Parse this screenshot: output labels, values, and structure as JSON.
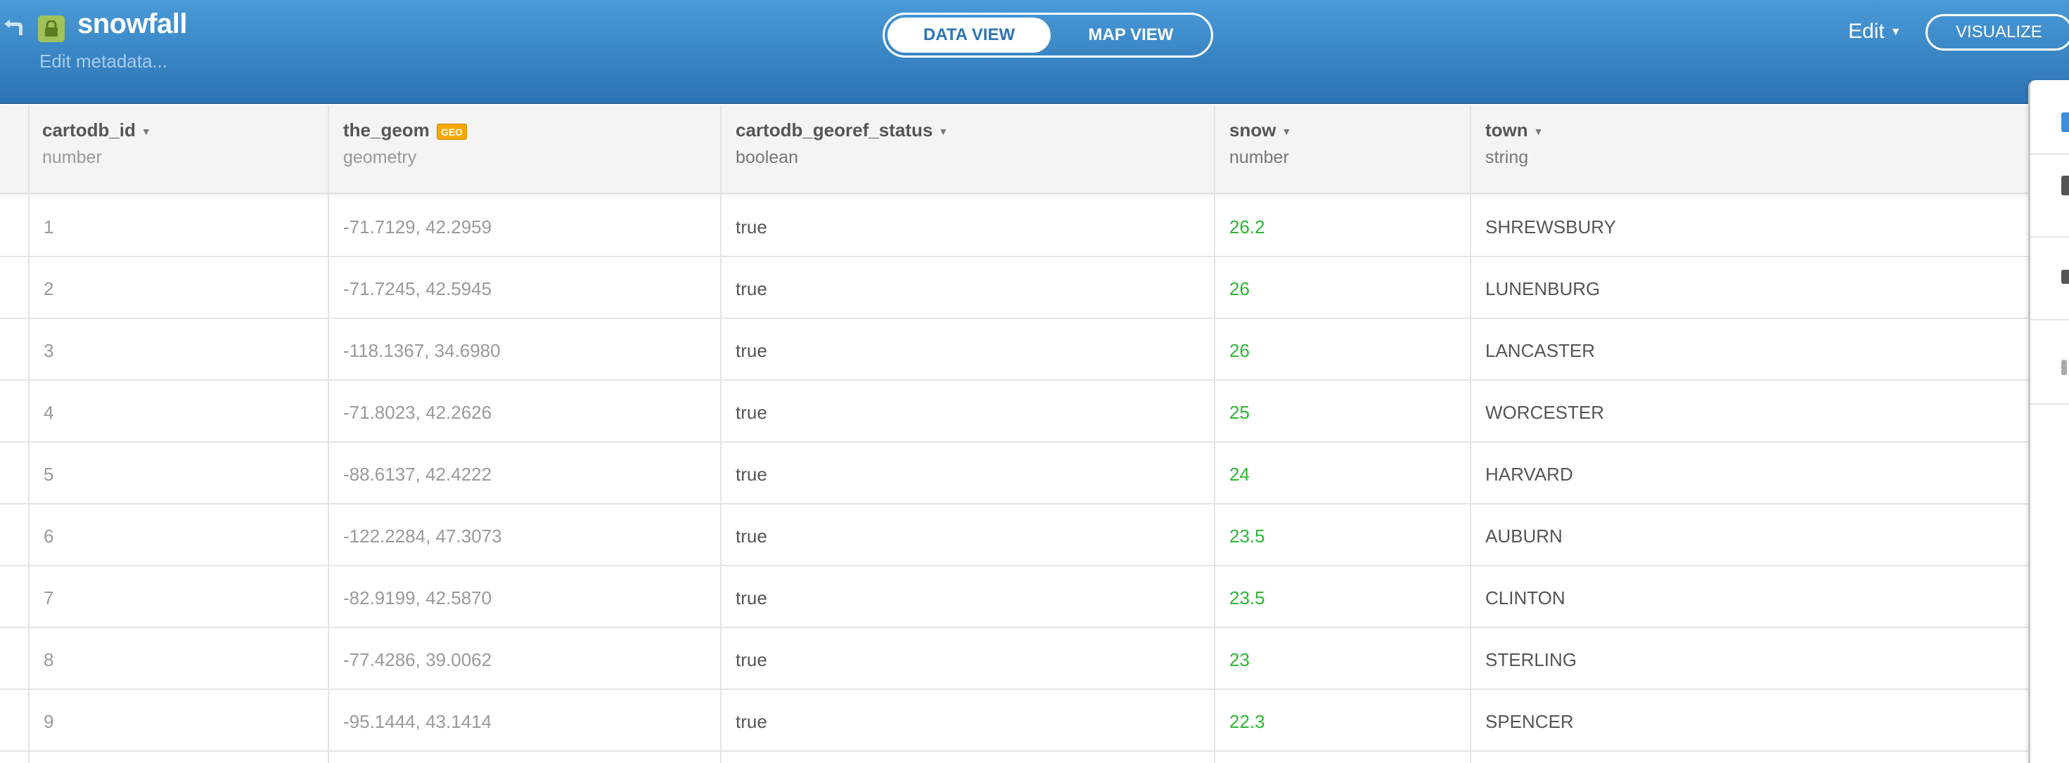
{
  "header": {
    "title": "snowfall",
    "edit_metadata": "Edit metadata...",
    "tabs": [
      "DATA VIEW",
      "MAP VIEW"
    ],
    "active_tab": "DATA VIEW",
    "edit_label": "Edit",
    "visualize_label": "VISUALIZE",
    "icons": {
      "back": "back-arrow-icon",
      "lock": "lock-icon"
    }
  },
  "table": {
    "columns": [
      {
        "name": "cartodb_id",
        "type": "number"
      },
      {
        "name": "the_geom",
        "type": "geometry",
        "badge": "GEO"
      },
      {
        "name": "cartodb_georef_status",
        "type": "boolean"
      },
      {
        "name": "snow",
        "type": "number"
      },
      {
        "name": "town",
        "type": "string"
      }
    ],
    "rows": [
      [
        "1",
        "-71.7129, 42.2959",
        "true",
        "26.2",
        "SHREWSBURY"
      ],
      [
        "2",
        "-71.7245, 42.5945",
        "true",
        "26",
        "LUNENBURG"
      ],
      [
        "3",
        "-118.1367, 34.6980",
        "true",
        "26",
        "LANCASTER"
      ],
      [
        "4",
        "-71.8023, 42.2626",
        "true",
        "25",
        "WORCESTER"
      ],
      [
        "5",
        "-88.6137, 42.4222",
        "true",
        "24",
        "HARVARD"
      ],
      [
        "6",
        "-122.2284, 47.3073",
        "true",
        "23.5",
        "AUBURN"
      ],
      [
        "7",
        "-82.9199, 42.5870",
        "true",
        "23.5",
        "CLINTON"
      ],
      [
        "8",
        "-77.4286, 39.0062",
        "true",
        "23",
        "STERLING"
      ],
      [
        "9",
        "-95.1444, 43.1414",
        "true",
        "22.3",
        "SPENCER"
      ]
    ]
  },
  "colors": {
    "header_top": "#4a9ad8",
    "header_bottom": "#2c74b4",
    "number_green": "#2eb534",
    "geo_badge": "#f7a700"
  }
}
